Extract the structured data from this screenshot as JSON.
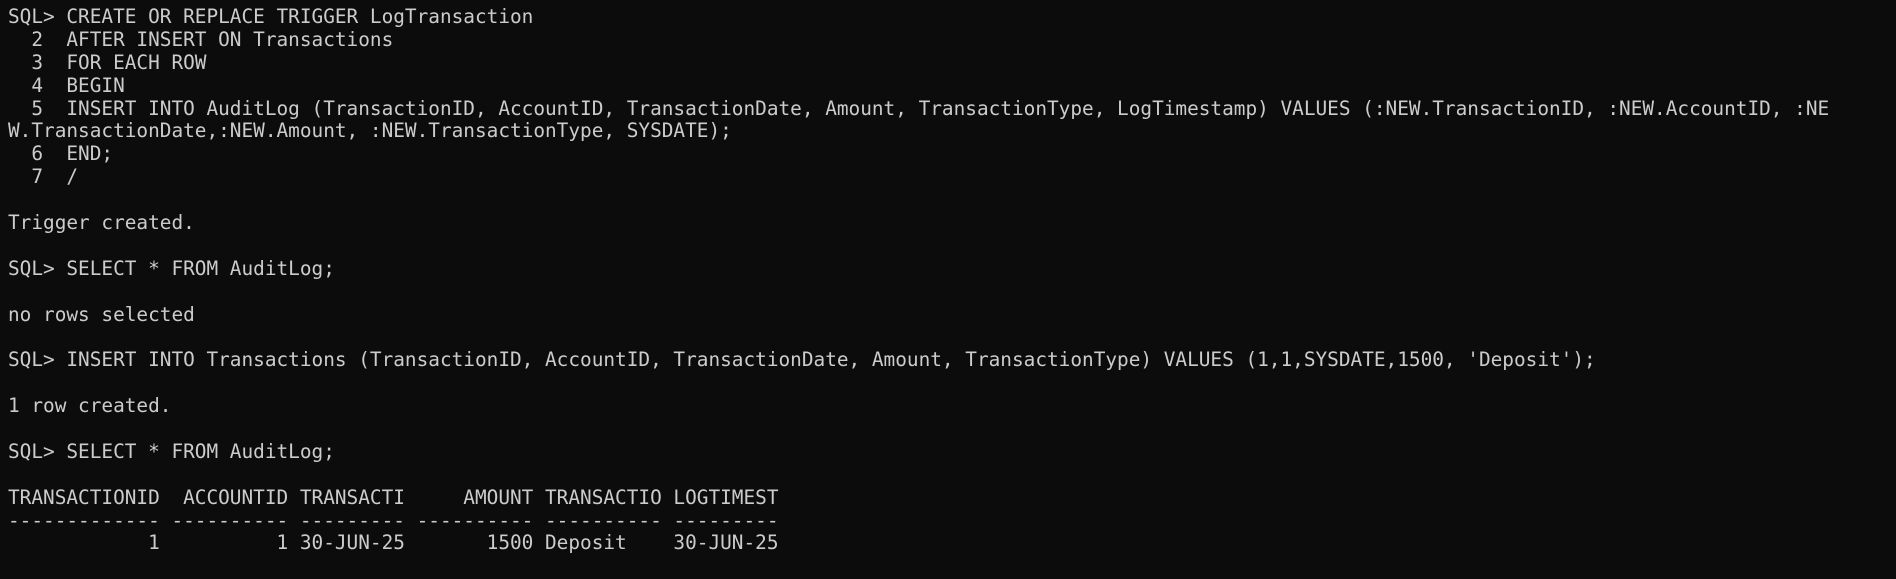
{
  "terminal": {
    "background": "#0c0c0c",
    "foreground": "#cccccc",
    "lines": [
      "SQL> CREATE OR REPLACE TRIGGER LogTransaction",
      "  2  AFTER INSERT ON Transactions",
      "  3  FOR EACH ROW",
      "  4  BEGIN",
      "  5  INSERT INTO AuditLog (TransactionID, AccountID, TransactionDate, Amount, TransactionType, LogTimestamp) VALUES (:NEW.TransactionID, :NEW.AccountID, :NE",
      "W.TransactionDate,:NEW.Amount, :NEW.TransactionType, SYSDATE);",
      "  6  END;",
      "  7  /",
      "",
      "Trigger created.",
      "",
      "SQL> SELECT * FROM AuditLog;",
      "",
      "no rows selected",
      "",
      "SQL> INSERT INTO Transactions (TransactionID, AccountID, TransactionDate, Amount, TransactionType) VALUES (1,1,SYSDATE,1500, 'Deposit');",
      "",
      "1 row created.",
      "",
      "SQL> SELECT * FROM AuditLog;",
      "",
      "TRANSACTIONID  ACCOUNTID TRANSACTI     AMOUNT TRANSACTIO LOGTIMEST",
      "------------- ---------- --------- ---------- ---------- ---------",
      "            1          1 30-JUN-25       1500 Deposit    30-JUN-25"
    ]
  }
}
